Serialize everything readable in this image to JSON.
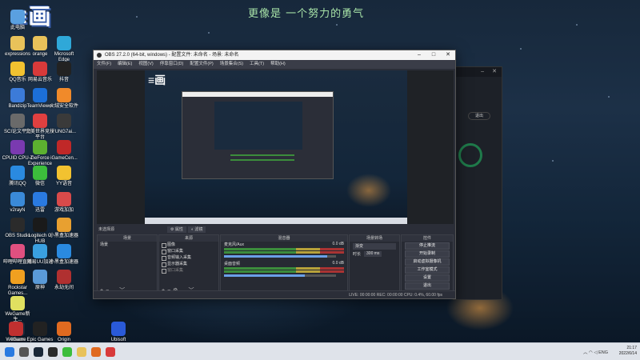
{
  "overlay": {
    "poem": "更像是 一个努力的勇气"
  },
  "badge": {
    "text": "≡画"
  },
  "desktop_icons": [
    {
      "label": "此电脑",
      "color": "#5aa0e0"
    },
    {
      "label": "expressions",
      "color": "#e8c25a"
    },
    {
      "label": "orange",
      "color": "#e8c25a"
    },
    {
      "label": "Microsoft Edge",
      "color": "#2fa8d8"
    },
    {
      "label": "QQ音乐",
      "color": "#f2c230"
    },
    {
      "label": "网易云音乐",
      "color": "#d83a3a"
    },
    {
      "label": "抖音",
      "color": "#222222"
    },
    {
      "label": "Bandizip",
      "color": "#3c7bd8"
    },
    {
      "label": "TeamViewer",
      "color": "#1c6fd8"
    },
    {
      "label": "火绒安全软件",
      "color": "#f08a2a"
    },
    {
      "label": "SCI论文平台",
      "color": "#6a6a6a"
    },
    {
      "label": "完美世界竞技平台",
      "color": "#e04040"
    },
    {
      "label": "FUNG7ai...",
      "color": "#3a3a3a"
    },
    {
      "label": "CPUID CPU-Z",
      "color": "#7a3ab0"
    },
    {
      "label": "GeForce Experience",
      "color": "#5cb030"
    },
    {
      "label": "iGameCen...",
      "color": "#c02828"
    },
    {
      "label": "腾讯QQ",
      "color": "#2a8ae0"
    },
    {
      "label": "微信",
      "color": "#3cbd3c"
    },
    {
      "label": "YY语音",
      "color": "#f2c230"
    },
    {
      "label": "v2rayN",
      "color": "#3a8ad8"
    },
    {
      "label": "迅雷",
      "color": "#2a7ae0"
    },
    {
      "label": "游戏加加",
      "color": "#d84a4a"
    },
    {
      "label": "OBS Studio",
      "color": "#2b2b2b"
    },
    {
      "label": "Logitech G HUB",
      "color": "#1a1a1a"
    },
    {
      "label": "小黑盒加速器",
      "color": "#e8a030"
    },
    {
      "label": "哔哩哔哩直播",
      "color": "#e05080"
    },
    {
      "label": "网易UU加速",
      "color": "#3aa0e0"
    },
    {
      "label": "小黑盒加速器",
      "color": "#2a8ae0"
    },
    {
      "label": "Rockstar Games...",
      "color": "#f0a020"
    },
    {
      "label": "原神",
      "color": "#5a9ad8"
    },
    {
      "label": "永劫无间",
      "color": "#b03030"
    },
    {
      "label": "WeGame新生...",
      "color": "#e0e060"
    },
    {
      "label": "Steam",
      "color": "#1b2838"
    },
    {
      "label": "Epic Games Launcher",
      "color": "#222222"
    },
    {
      "label": "Origin",
      "color": "#e06a20"
    },
    {
      "label": "Ubisoft Connect",
      "color": "#2a5ad8"
    },
    {
      "label": "WeGame",
      "color": "#c03030"
    }
  ],
  "obs": {
    "title": "OBS 27.2.0 (64-bit, windows) - 配置文件: 未命名 - 场景: 未命名",
    "menu": [
      "文件(F)",
      "编辑(E)",
      "视图(V)",
      "停靠窗口(D)",
      "配置文件(P)",
      "场景集合(S)",
      "工具(T)",
      "帮助(H)"
    ],
    "no_source_label": "未选择源",
    "props_button": "属性",
    "filters_button": "滤镜",
    "docks": {
      "scenes": {
        "title": "场景",
        "items": [
          "场景"
        ]
      },
      "sources": {
        "title": "来源",
        "items": [
          "图像",
          "窗口采集",
          "音频输入采集",
          "显示器采集",
          "窗口采集"
        ]
      },
      "mixer": {
        "title": "混音器",
        "channels": [
          {
            "name": "麦克风/Aux",
            "db": "0.0 dB",
            "level": 0.92
          },
          {
            "name": "桌面音频",
            "db": "0.0 dB",
            "level": 0.72
          }
        ]
      },
      "transitions": {
        "title": "场景转场",
        "type": "渐变",
        "duration_label": "时长",
        "duration": "300 ms"
      },
      "controls": {
        "title": "控件",
        "buttons": [
          "停止推流",
          "开始录制",
          "启动虚拟摄像机",
          "工作室模式",
          "设置",
          "退出"
        ]
      }
    },
    "status": "LIVE: 00:00:00  REC: 00:00:00  CPU: 0.4%, 60.00 fps"
  },
  "bgapp": {
    "exit_label": "退出"
  },
  "taskbar": {
    "tray_lang": "ENG",
    "time": "21:17",
    "date": "2022/6/14"
  }
}
